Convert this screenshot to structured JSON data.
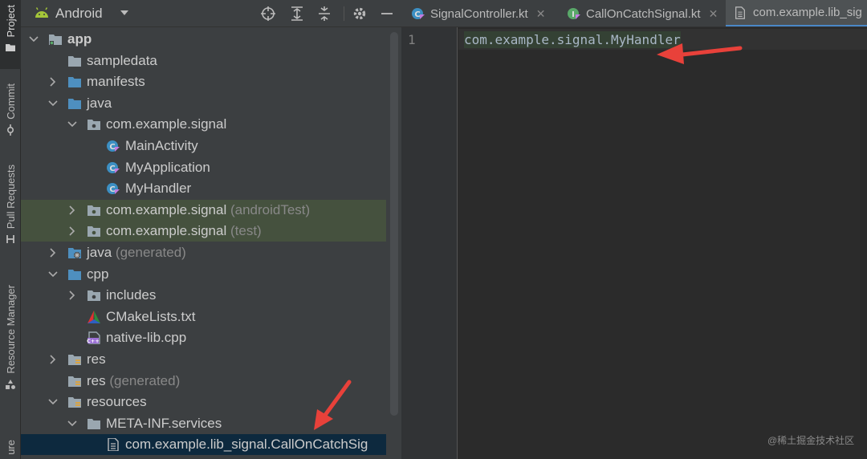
{
  "side_strip": {
    "tabs": [
      {
        "label": "Project",
        "active": true
      },
      {
        "label": "Commit",
        "active": false
      },
      {
        "label": "Pull Requests",
        "active": false
      },
      {
        "label": "Resource Manager",
        "active": false
      },
      {
        "label": "ure",
        "active": false
      }
    ]
  },
  "project_panel": {
    "view_name": "Android",
    "header_icons": [
      "crosshair-icon",
      "expand-all-icon",
      "collapse-all-icon",
      "gear-icon",
      "minimize-icon"
    ],
    "tree": [
      {
        "label": "app",
        "suffix": "",
        "icon": "module-icon",
        "expanded": true,
        "bold": true
      },
      {
        "label": "sampledata",
        "suffix": "",
        "icon": "folder-icon"
      },
      {
        "label": "manifests",
        "suffix": "",
        "icon": "folder-icon",
        "expanded": false
      },
      {
        "label": "java",
        "suffix": "",
        "icon": "folder-icon",
        "expanded": true
      },
      {
        "label": "com.example.signal",
        "suffix": "",
        "icon": "package-icon",
        "expanded": true
      },
      {
        "label": "MainActivity",
        "suffix": "",
        "icon": "kotlin-class-icon"
      },
      {
        "label": "MyApplication",
        "suffix": "",
        "icon": "kotlin-class-icon"
      },
      {
        "label": "MyHandler",
        "suffix": "",
        "icon": "kotlin-class-icon"
      },
      {
        "label": "com.example.signal",
        "suffix": "(androidTest)",
        "icon": "package-icon",
        "expanded": false,
        "highlight": true
      },
      {
        "label": "com.example.signal",
        "suffix": "(test)",
        "icon": "package-icon",
        "expanded": false,
        "highlight": true
      },
      {
        "label": "java",
        "suffix": "(generated)",
        "icon": "generated-folder-icon",
        "expanded": false
      },
      {
        "label": "cpp",
        "suffix": "",
        "icon": "folder-icon",
        "expanded": true
      },
      {
        "label": "includes",
        "suffix": "",
        "icon": "package-icon",
        "expanded": false
      },
      {
        "label": "CMakeLists.txt",
        "suffix": "",
        "icon": "cmake-icon"
      },
      {
        "label": "native-lib.cpp",
        "suffix": "",
        "icon": "cpp-file-icon"
      },
      {
        "label": "res",
        "suffix": "",
        "icon": "resource-folder-icon",
        "expanded": false
      },
      {
        "label": "res",
        "suffix": "(generated)",
        "icon": "resource-folder-icon"
      },
      {
        "label": "resources",
        "suffix": "",
        "icon": "resource-folder-icon",
        "expanded": true
      },
      {
        "label": "META-INF.services",
        "suffix": "",
        "icon": "folder-icon",
        "expanded": true
      },
      {
        "label": "com.example.lib_signal.CallOnCatchSig",
        "suffix": "",
        "icon": "text-file-icon",
        "selected": true
      }
    ]
  },
  "editor": {
    "tabs": [
      {
        "label": "SignalController.kt",
        "icon": "kotlin-class-icon",
        "active": false
      },
      {
        "label": "CallOnCatchSignal.kt",
        "icon": "kotlin-interface-icon",
        "active": false
      },
      {
        "label": "com.example.lib_sig",
        "icon": "text-file-icon",
        "active": true
      }
    ],
    "lines": [
      {
        "number": "1",
        "text": "com.example.signal.MyHandler"
      }
    ]
  },
  "watermark": "@稀土掘金技术社区",
  "colors": {
    "arrow": "#e8413a",
    "highlight_row": "#45513e",
    "selected_row": "#0d293e",
    "active_tab_underline": "#4a88c7"
  }
}
